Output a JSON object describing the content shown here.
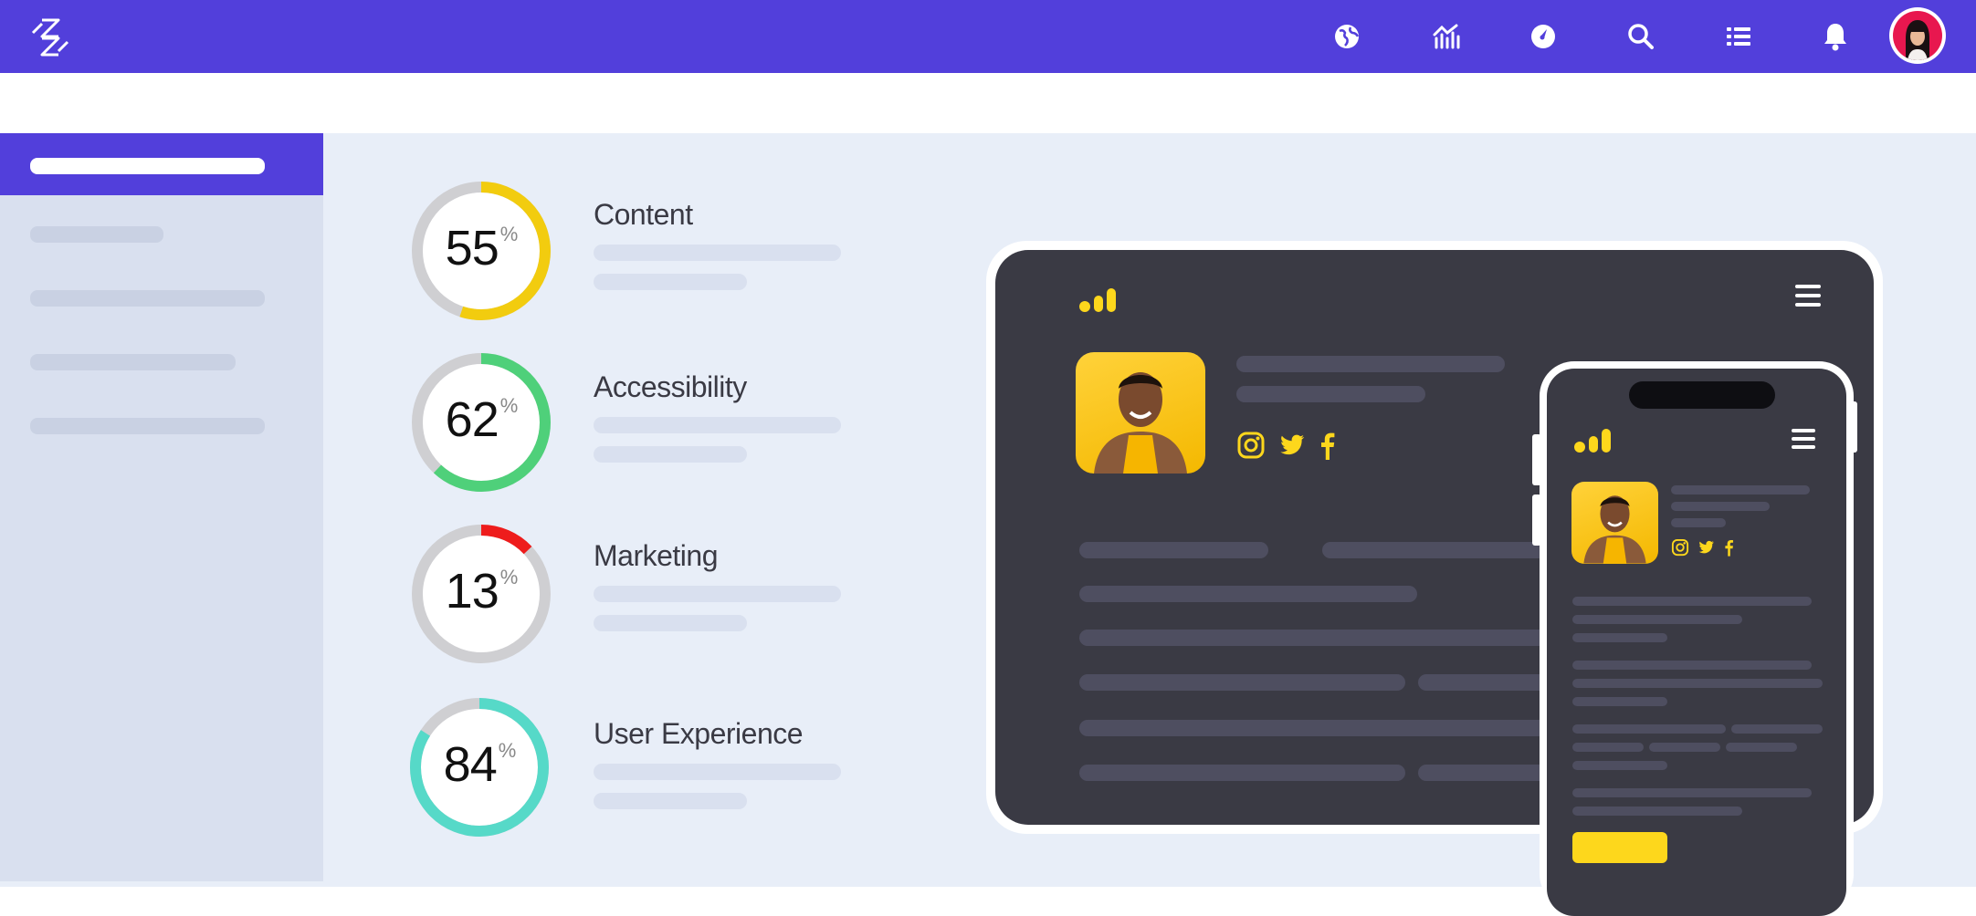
{
  "header": {
    "background": "#523fdb",
    "nav_icons": [
      "globe-icon",
      "chart-icon",
      "compass-icon",
      "search-icon",
      "list-icon",
      "bell-icon"
    ]
  },
  "metrics": [
    {
      "label": "Content",
      "value": 55,
      "unit": "%",
      "color": "#f2cc0f"
    },
    {
      "label": "Accessibility",
      "value": 62,
      "unit": "%",
      "color": "#4fd07a"
    },
    {
      "label": "Marketing",
      "value": 13,
      "unit": "%",
      "color": "#ee1c1c"
    },
    {
      "label": "User Experience",
      "value": 84,
      "unit": "%",
      "color": "#56d9c8"
    }
  ],
  "colors": {
    "accent": "#523fdb",
    "page_bg": "#e8eef8",
    "sidebar_bg": "#d9e0ef",
    "device_bg": "#3a3a44",
    "highlight": "#fdd71c"
  },
  "preview": {
    "social_icons": [
      "instagram-icon",
      "twitter-icon",
      "facebook-icon"
    ]
  }
}
